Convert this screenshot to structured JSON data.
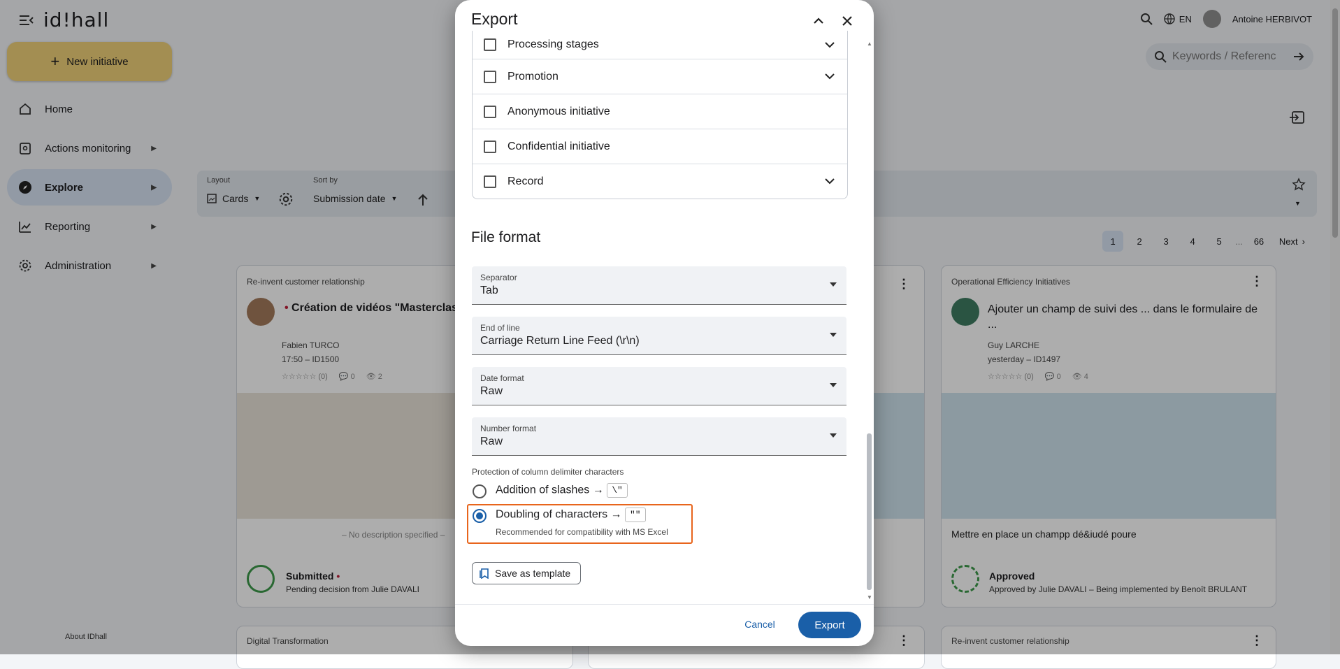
{
  "app": {
    "logo_text": "id!hall",
    "new_initiative": "New initiative",
    "nav": [
      {
        "label": "Home",
        "icon": "home-icon"
      },
      {
        "label": "Actions monitoring",
        "icon": "clipboard-icon"
      },
      {
        "label": "Explore",
        "icon": "compass-icon"
      },
      {
        "label": "Reporting",
        "icon": "chart-icon"
      },
      {
        "label": "Administration",
        "icon": "gear-icon"
      }
    ],
    "about": "About IDhall",
    "lang": "EN",
    "user": "Antoine HERBIVOT",
    "search_placeholder": "Keywords / Referenc"
  },
  "toolbar": {
    "layout_label": "Layout",
    "layout_value": "Cards",
    "sort_label": "Sort by",
    "sort_value": "Submission date"
  },
  "pager": {
    "pages": [
      "1",
      "2",
      "3",
      "4",
      "5"
    ],
    "ellipsis": "...",
    "last": "66",
    "next": "Next"
  },
  "cards": [
    {
      "category": "Re-invent customer relationship",
      "title": "Création de vidéos \"Masterclass",
      "author": "Fabien TURCO",
      "meta": "17:50 – ID1500",
      "rating": "☆☆☆☆☆ (0)",
      "comments": "0",
      "views": "2",
      "description": "– No description specified –",
      "status": "Submitted",
      "status_detail": "Pending decision from Julie DAVALI"
    },
    {
      "category": "Operational Efficiency Initiatives",
      "title": "Ajouter un champ de suivi des ... dans le formulaire de",
      "title_cont": "...",
      "author": "Guy LARCHE",
      "meta": "yesterday – ID1497",
      "rating": "☆☆☆☆☆ (0)",
      "comments": "0",
      "views": "4",
      "description": "Mettre en place un champp dé&iudé poure",
      "status": "Approved",
      "status_detail": "Approved by Julie DAVALI – Being implemented by Benoît BRULANT"
    }
  ],
  "bottom_cards": [
    "Digital Transformation",
    "Re-invent customer relationship"
  ],
  "dialog": {
    "title": "Export",
    "rows": [
      {
        "label": "Processing stages",
        "expandable": true
      },
      {
        "label": "Promotion",
        "expandable": true
      },
      {
        "label": "Anonymous initiative",
        "expandable": false
      },
      {
        "label": "Confidential initiative",
        "expandable": false
      },
      {
        "label": "Record",
        "expandable": true
      }
    ],
    "file_format": "File format",
    "fields": [
      {
        "label": "Separator",
        "value": "Tab"
      },
      {
        "label": "End of line",
        "value": "Carriage Return Line Feed (\\r\\n)"
      },
      {
        "label": "Date format",
        "value": "Raw"
      },
      {
        "label": "Number format",
        "value": "Raw"
      }
    ],
    "protection_label": "Protection of column delimiter characters",
    "option1_label": "Addition of slashes →",
    "option1_code": "\\\"",
    "option2_label": "Doubling of characters →",
    "option2_code": "\"\"",
    "option2_hint": "Recommended for compatibility with MS Excel",
    "selected_option": "Doubling of characters",
    "save_template": "Save as template",
    "cancel": "Cancel",
    "export": "Export"
  }
}
